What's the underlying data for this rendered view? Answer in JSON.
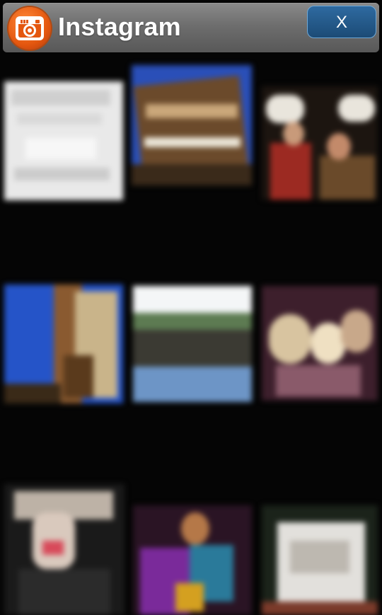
{
  "header": {
    "title": "Instagram",
    "close_label": "X",
    "logo_icon": "instagram-camera-icon"
  },
  "colors": {
    "background": "#050505",
    "header": "#6e6e6e",
    "logo": "#e4570f",
    "close_button": "#1c4b76"
  },
  "grid": {
    "items": [
      {
        "caption_1": "",
        "caption_2": ""
      },
      {
        "caption_1": "",
        "caption_2": ""
      },
      {
        "caption_1": "",
        "caption_2": ""
      },
      {
        "caption_1": "",
        "caption_2": ""
      },
      {
        "caption_1": "",
        "caption_2": ""
      },
      {
        "caption_1": "",
        "caption_2": ""
      },
      {
        "caption_1": "",
        "caption_2": ""
      },
      {
        "caption_1": "",
        "caption_2": ""
      },
      {
        "caption_1": "",
        "caption_2": ""
      }
    ]
  }
}
